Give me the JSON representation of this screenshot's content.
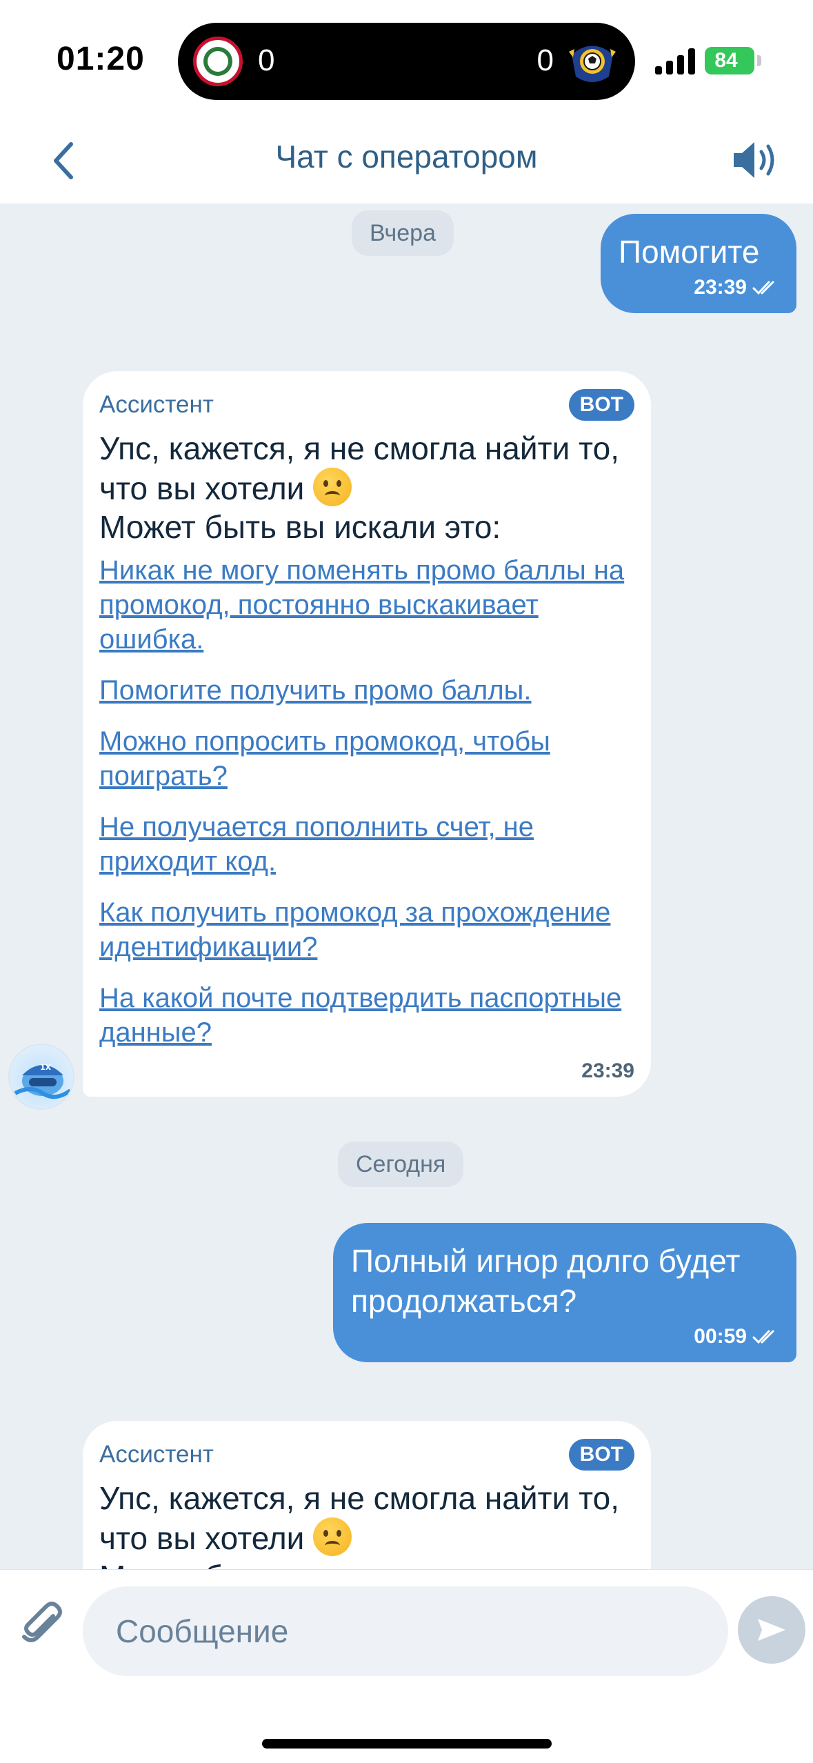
{
  "status_bar": {
    "time": "01:20",
    "score_left": "0",
    "score_right": "0",
    "battery": "84"
  },
  "header": {
    "title": "Чат с оператором"
  },
  "chat": {
    "date_yesterday": "Вчера",
    "date_today": "Сегодня",
    "messages": [
      {
        "type": "outgoing",
        "text": "Помогите",
        "time": "23:39"
      },
      {
        "type": "incoming",
        "sender": "Ассистент",
        "badge": "BOT",
        "text_line1": "Упс, кажется, я не смогла найти то, что вы хотели",
        "text_line2": "Может быть вы искали это:",
        "links": [
          "Никак не могу поменять промо баллы на промокод, постоянно выскакивает ошибка.",
          "Помогите получить промо баллы.",
          "Можно попросить промокод, чтобы поиграть?",
          "Не получается пополнить счет, не приходит код.",
          "Как получить промокод за прохождение идентификации?",
          "На какой почте подтвердить паспортные данные?"
        ],
        "time": "23:39"
      },
      {
        "type": "outgoing",
        "text": "Полный игнор долго будет продолжаться?",
        "time": "00:59"
      },
      {
        "type": "incoming",
        "sender": "Ассистент",
        "badge": "BOT",
        "text_line1": "Упс, кажется, я не смогла найти то, что вы хотели",
        "text_line2": "Может быть вы искали это:"
      }
    ]
  },
  "input": {
    "placeholder": "Сообщение"
  },
  "icons": {
    "back": "chevron-left-icon",
    "sound": "speaker-icon",
    "attach": "paperclip-icon",
    "send": "send-arrow-icon"
  },
  "colors": {
    "accent": "#4a90d9",
    "header_title": "#2f5f86",
    "link": "#3b7bc4",
    "chat_bg": "#eaeff4",
    "battery": "#34c759"
  }
}
